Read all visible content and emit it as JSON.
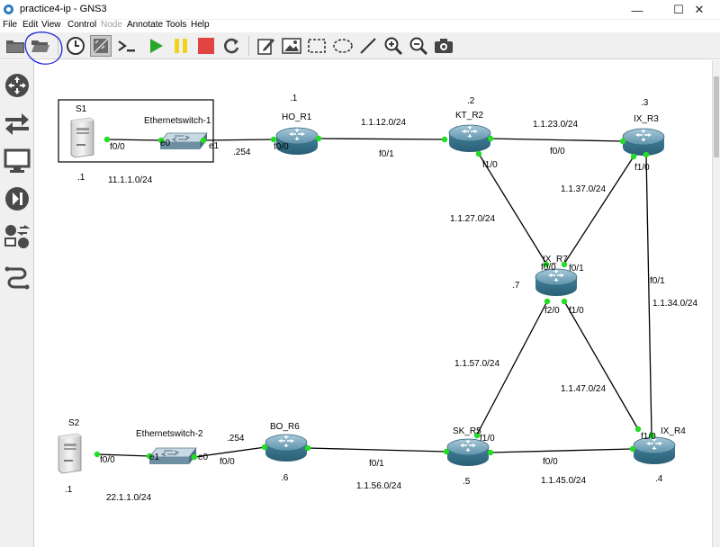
{
  "window": {
    "title": "practice4-ip - GNS3",
    "controls": {
      "minimize": "—",
      "maximize": "☐",
      "close": "✕"
    }
  },
  "menu": {
    "items": [
      "File",
      "Edit",
      "View",
      "Control",
      "Node",
      "Annotate",
      "Tools",
      "Help"
    ],
    "disabled": [
      "Node"
    ]
  },
  "toolbar": {
    "buttons": [
      "folder-icon",
      "open-folder-icon",
      "clock-icon",
      "snapshot-grid-icon",
      "console-icon",
      "start-icon",
      "suspend-icon",
      "stop-icon",
      "reload-icon",
      "edit-note-icon",
      "insert-image-icon",
      "rectangle-icon",
      "ellipse-icon",
      "line-icon",
      "zoom-in-icon",
      "zoom-out-icon",
      "screenshot-icon"
    ],
    "annotation_color": "#1c28d8"
  },
  "devicebar": {
    "buttons": [
      "routers-icon",
      "switches-icon",
      "end-devices-icon",
      "security-devices-icon",
      "all-devices-icon",
      "add-link-icon"
    ]
  },
  "colors": {
    "port_dot": "#22dd22",
    "link": "#000000",
    "router_body": "#3f7f99",
    "stop": "#e24444",
    "start": "#2aa52a",
    "suspend": "#f2d21c"
  },
  "topology": {
    "nodes": {
      "s1": {
        "label": "S1",
        "addr": ".1"
      },
      "sw1": {
        "label": "Ethernetswitch-1"
      },
      "ho_r1": {
        "label": "HO_R1",
        "addr": ".1"
      },
      "kt_r2": {
        "label": "KT_R2",
        "addr": ".2"
      },
      "ix_r3": {
        "label": "IX_R3",
        "addr": ".3"
      },
      "ix_r7": {
        "label": "IX_R7",
        "addr": ".7"
      },
      "ix_r4": {
        "label": "IX_R4",
        "addr": ".4"
      },
      "sk_r5": {
        "label": "SK_R5",
        "addr": ".5"
      },
      "bo_r6": {
        "label": "BO_R6",
        "addr": ".6"
      },
      "sw2": {
        "label": "Ethernetswitch-2"
      },
      "s2": {
        "label": "S2",
        "addr": ".1"
      }
    },
    "ports": {
      "s1_f00": "f0/0",
      "sw1_e0": "e0",
      "sw1_e1": "e1",
      "ho_r1_f00": "f0/0",
      "ho_r1_f01": "f0/1",
      "kt_r2_f10": "f1/0",
      "kt_r2_f00": "f0/0",
      "ix_r3_f10": "f1/0",
      "ix_r3_f01": "f0/1",
      "ix_r7_f00": "f0/0",
      "ix_r7_f01": "f0/1",
      "ix_r7_f20": "f2/0",
      "ix_r7_f10": "f1/0",
      "sk_r5_f10": "f1/0",
      "sk_r5_f00": "f0/0",
      "ix_r4_f10": "f1/0",
      "bo_r6_f00": "f0/0",
      "bo_r6_f01": "f0/1",
      "sw2_e1": "e1",
      "sw2_e0": "e0",
      "s2_f00": "f0/0"
    },
    "networks": {
      "n_s1": "11.1.1.0/24",
      "n_sw1_gw": ".254",
      "n_12": "1.1.12.0/24",
      "n_23": "1.1.23.0/24",
      "n_37": "1.1.37.0/24",
      "n_27": "1.1.27.0/24",
      "n_34": "1.1.34.0/24",
      "n_57": "1.1.57.0/24",
      "n_47": "1.1.47.0/24",
      "n_56": "1.1.56.0/24",
      "n_45": "1.1.45.0/24",
      "n_s2": "22.1.1.0/24",
      "n_sw2_gw": ".254"
    }
  }
}
